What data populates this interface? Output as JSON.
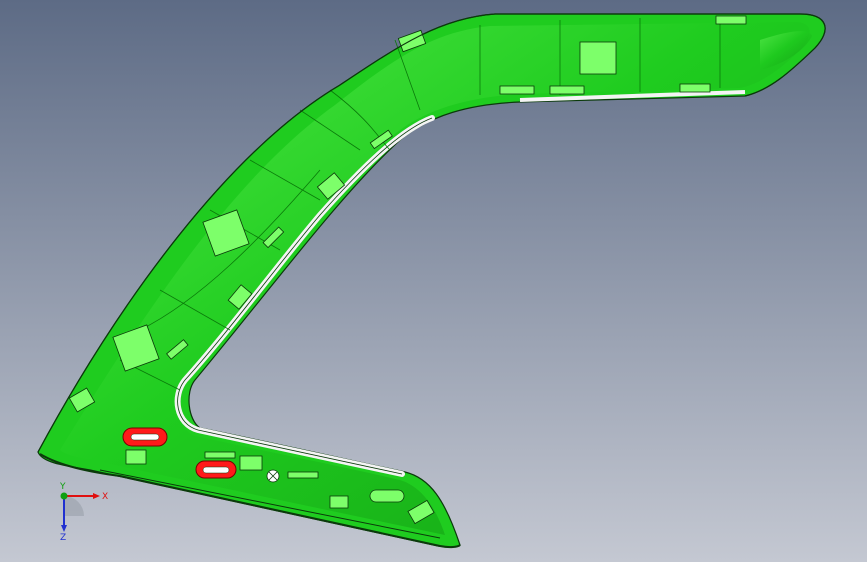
{
  "scene": {
    "background_top": "#5d6b85",
    "background_bottom": "#c4c8d2",
    "part_color": "#1fcc1f",
    "part_dark": "#0a7a0a",
    "part_light": "#7dff6a",
    "highlight_color": "#ff1a1a",
    "inner_band": "#f4f4f4",
    "edge_color": "#0b3a0b"
  },
  "triad": {
    "x_label": "X",
    "y_label": "Y",
    "z_label": "Z",
    "x_color": "#e01010",
    "y_color": "#10a010",
    "z_color": "#2030d0"
  }
}
